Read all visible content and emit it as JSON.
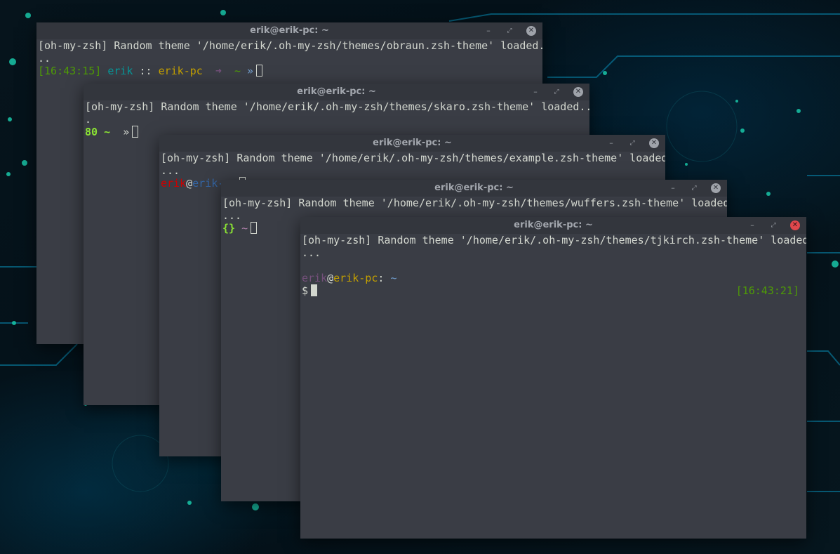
{
  "windows": [
    {
      "title": "erik@erik-pc: ~",
      "line1": "[oh-my-zsh] Random theme '/home/erik/.oh-my-zsh/themes/obraun.zsh-theme' loaded.",
      "line2": "..",
      "prompt": {
        "time": "[16:43:15]",
        "user": "erik",
        "sep": "::",
        "host": "erik-pc",
        "arrow": "➜",
        "dir": "~",
        "char": "»"
      }
    },
    {
      "title": "erik@erik-pc: ~",
      "line1": "[oh-my-zsh] Random theme '/home/erik/.oh-my-zsh/themes/skaro.zsh-theme' loaded..",
      "line2": ".",
      "prompt": {
        "num": "80",
        "dir": "~",
        "char": "»"
      }
    },
    {
      "title": "erik@erik-pc: ~",
      "line1": "[oh-my-zsh] Random theme '/home/erik/.oh-my-zsh/themes/example.zsh-theme' loaded",
      "line2": "...",
      "prompt": {
        "user": "erik",
        "at": "@",
        "host": "erik-pc"
      }
    },
    {
      "title": "erik@erik-pc: ~",
      "line1": "[oh-my-zsh] Random theme '/home/erik/.oh-my-zsh/themes/wuffers.zsh-theme' loaded",
      "line2": "...",
      "prompt": {
        "braces": "{}",
        "dir": "~"
      }
    },
    {
      "title": "erik@erik-pc: ~",
      "line1": "[oh-my-zsh] Random theme '/home/erik/.oh-my-zsh/themes/tjkirch.zsh-theme' loaded",
      "line2": "...",
      "prompt": {
        "user": "erik",
        "at": "@",
        "host": "erik-pc",
        "colon": ":",
        "dir": "~",
        "char": "$",
        "rtime": "[16:43:21]"
      }
    }
  ],
  "window_controls": {
    "minimize": "–",
    "maximize": "⤢",
    "close": "✕"
  },
  "colors": {
    "terminal_bg": "#3a3d45",
    "titlebar_bg": "#33363d",
    "title_text": "#a3a7ae",
    "close_active": "#e0474c"
  }
}
